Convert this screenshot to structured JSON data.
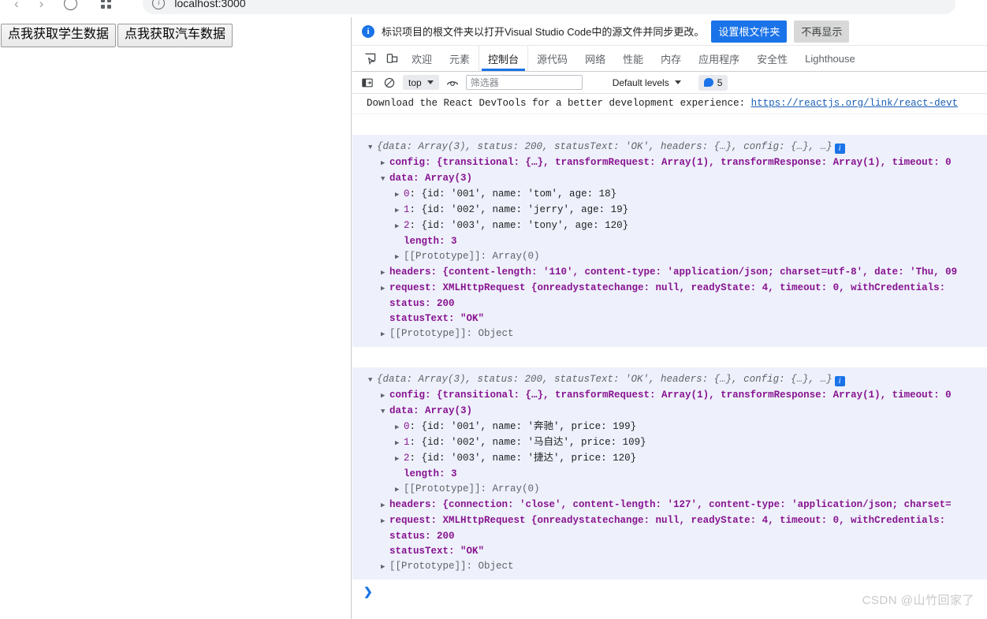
{
  "browser": {
    "back_icon": "‹",
    "forward_icon": "›",
    "url": "localhost:3000"
  },
  "page": {
    "buttons": [
      {
        "label": "点我获取学生数据"
      },
      {
        "label": "点我获取汽车数据"
      }
    ]
  },
  "devtools": {
    "banner": {
      "icon": "i",
      "text": "标识项目的根文件夹以打开Visual Studio Code中的源文件并同步更改。",
      "primary_button": "设置根文件夹",
      "secondary_button": "不再显示"
    },
    "tabs": [
      {
        "label": "欢迎",
        "selected": false
      },
      {
        "label": "元素",
        "selected": false
      },
      {
        "label": "控制台",
        "selected": true
      },
      {
        "label": "源代码",
        "selected": false
      },
      {
        "label": "网络",
        "selected": false
      },
      {
        "label": "性能",
        "selected": false
      },
      {
        "label": "内存",
        "selected": false
      },
      {
        "label": "应用程序",
        "selected": false
      },
      {
        "label": "安全性",
        "selected": false
      },
      {
        "label": "Lighthouse",
        "selected": false
      }
    ],
    "console_toolbar": {
      "context": "top",
      "filter_placeholder": "筛选器",
      "filter_value": "",
      "levels": "Default levels",
      "message_count": "5"
    }
  },
  "console": {
    "react_notice": {
      "text": "Download the React DevTools for a better development experience: ",
      "link": "https://reactjs.org/link/react-devt"
    },
    "logs": [
      {
        "preview": "{data: Array(3), status: 200, statusText: 'OK', headers: {…}, config: {…}, …}",
        "config_line": "config: {transitional: {…}, transformRequest: Array(1), transformResponse: Array(1), timeout: 0",
        "data_label": "data: Array(3)",
        "items": [
          {
            "index": "0",
            "body": "{id: '001', name: 'tom', age: 18}"
          },
          {
            "index": "1",
            "body": "{id: '002', name: 'jerry', age: 19}"
          },
          {
            "index": "2",
            "body": "{id: '003', name: 'tony', age: 120}"
          }
        ],
        "length_line": "length: 3",
        "array_proto": "[[Prototype]]: Array(0)",
        "headers_line": "headers: {content-length: '110', content-type: 'application/json; charset=utf-8', date: 'Thu, 09",
        "request_line": "request: XMLHttpRequest {onreadystatechange: null, readyState: 4, timeout: 0, withCredentials: ",
        "status_line": "status: 200",
        "status_text_line": "statusText: \"OK\"",
        "object_proto": "[[Prototype]]: Object"
      },
      {
        "preview": "{data: Array(3), status: 200, statusText: 'OK', headers: {…}, config: {…}, …}",
        "config_line": "config: {transitional: {…}, transformRequest: Array(1), transformResponse: Array(1), timeout: 0",
        "data_label": "data: Array(3)",
        "items": [
          {
            "index": "0",
            "body": "{id: '001', name: '奔驰', price: 199}"
          },
          {
            "index": "1",
            "body": "{id: '002', name: '马自达', price: 109}"
          },
          {
            "index": "2",
            "body": "{id: '003', name: '捷达', price: 120}"
          }
        ],
        "length_line": "length: 3",
        "array_proto": "[[Prototype]]: Array(0)",
        "headers_line": "headers: {connection: 'close', content-length: '127', content-type: 'application/json; charset=",
        "request_line": "request: XMLHttpRequest {onreadystatechange: null, readyState: 4, timeout: 0, withCredentials: ",
        "status_line": "status: 200",
        "status_text_line": "statusText: \"OK\"",
        "object_proto": "[[Prototype]]: Object"
      }
    ],
    "prompt_arrow": "❯"
  },
  "watermark": "CSDN @山竹回家了"
}
